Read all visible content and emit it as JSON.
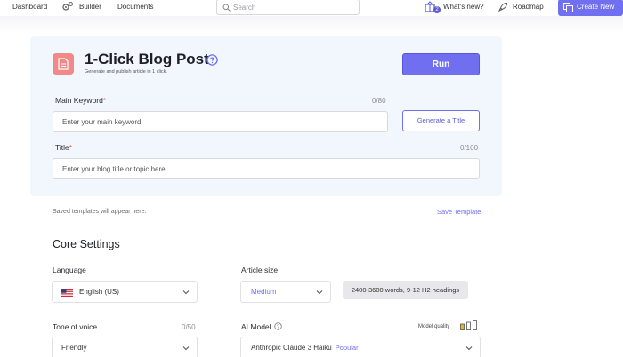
{
  "nav": {
    "dashboard": "Dashboard",
    "builder": "Builder",
    "documents": "Documents",
    "search_placeholder": "Search",
    "whats_new": "What's new?",
    "whats_new_count": "2",
    "roadmap": "Roadmap",
    "create_new": "Create New"
  },
  "card": {
    "title": "1-Click Blog Post",
    "subtitle": "Generate and publish article in 1 click.",
    "run_label": "Run",
    "main_keyword": {
      "label": "Main Keyword",
      "required_mark": "*",
      "counter": "0/80",
      "placeholder": "Enter your main keyword",
      "value": ""
    },
    "generate_title_label": "Generate a Title",
    "title_field": {
      "label": "Title",
      "required_mark": "*",
      "counter": "0/100",
      "placeholder": "Enter your blog title or topic here",
      "value": ""
    }
  },
  "templates": {
    "note": "Saved templates will appear here.",
    "save_label": "Save Template"
  },
  "core": {
    "title": "Core Settings",
    "language": {
      "label": "Language",
      "value": "English (US)"
    },
    "article_size": {
      "label": "Article size",
      "value": "Medium",
      "description": "2400-3600 words, 9-12 H2 headings"
    },
    "tone": {
      "label": "Tone of voice",
      "counter": "0/50",
      "value": "Friendly"
    },
    "ai_model": {
      "label": "AI Model",
      "quality_label": "Model quality",
      "value": "Anthropic Claude 3 Haiku",
      "tag": "Popular",
      "quality_level": 1,
      "quality_max": 3
    }
  },
  "colors": {
    "accent": "#6f6ff0",
    "card_bg": "#f2f7fd",
    "doc_icon": "#f08a8a",
    "required": "#e05656",
    "quality_bar": "#e6b422"
  }
}
